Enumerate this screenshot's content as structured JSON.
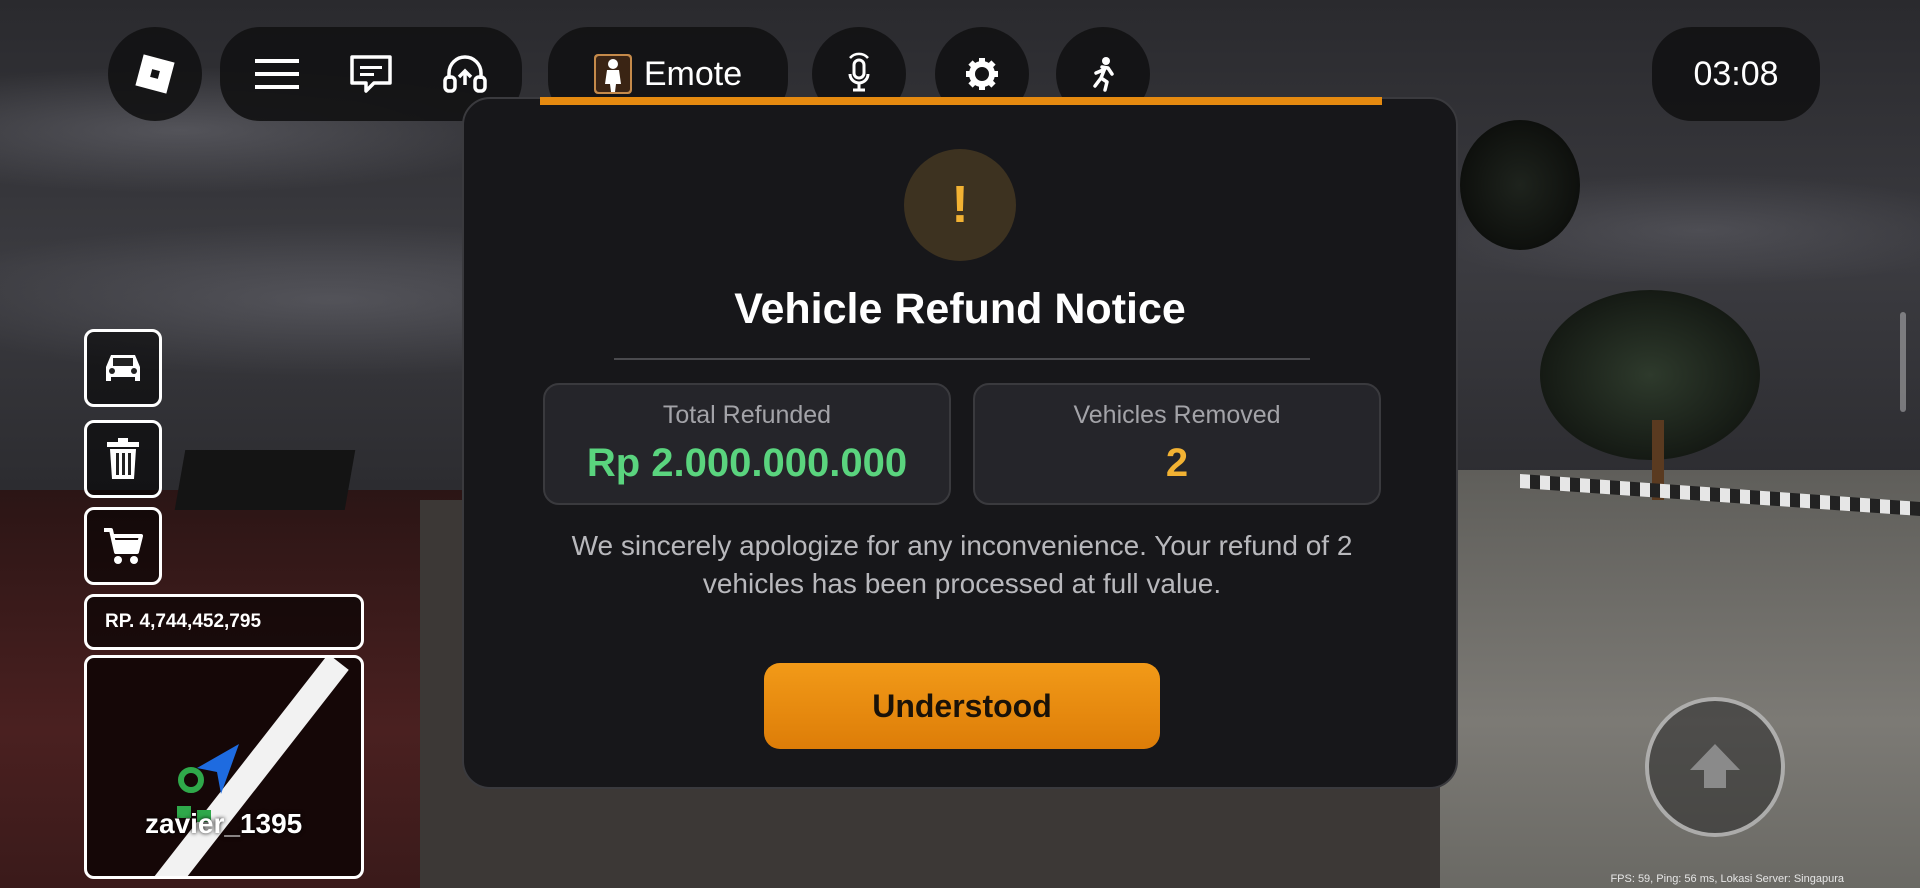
{
  "topbar": {
    "roblox_icon": "roblox-logo-icon",
    "menu_icon": "hamburger-menu-icon",
    "chat_icon": "chat-icon",
    "headset_icon": "headset-icon",
    "emote_label": "Emote",
    "voice_icon": "voice-mic-icon",
    "settings_icon": "gear-icon",
    "run_icon": "running-person-icon",
    "clock": "03:08"
  },
  "sidebar": {
    "car_icon": "car-icon",
    "trash_icon": "trash-icon",
    "cart_icon": "cart-icon",
    "money": "RP. 4,744,452,795"
  },
  "minimap": {
    "player_name": "zavier_1395"
  },
  "modal": {
    "title": "Vehicle Refund Notice",
    "warning_icon": "!",
    "total_refunded_label": "Total Refunded",
    "total_refunded_value": "Rp 2.000.000.000",
    "vehicles_removed_label": "Vehicles Removed",
    "vehicles_removed_value": "2",
    "message": "We sincerely apologize for any inconvenience. Your refund of 2 vehicles has been processed at full value.",
    "button_label": "Understood"
  },
  "status": {
    "stats_text": "FPS: 59, Ping: 56 ms, Lokasi Server: Singapura"
  },
  "colors": {
    "accent": "#e58a10",
    "refund_green": "#5ad47e",
    "count_gold": "#f2b233",
    "modal_bg": "#17171a"
  }
}
